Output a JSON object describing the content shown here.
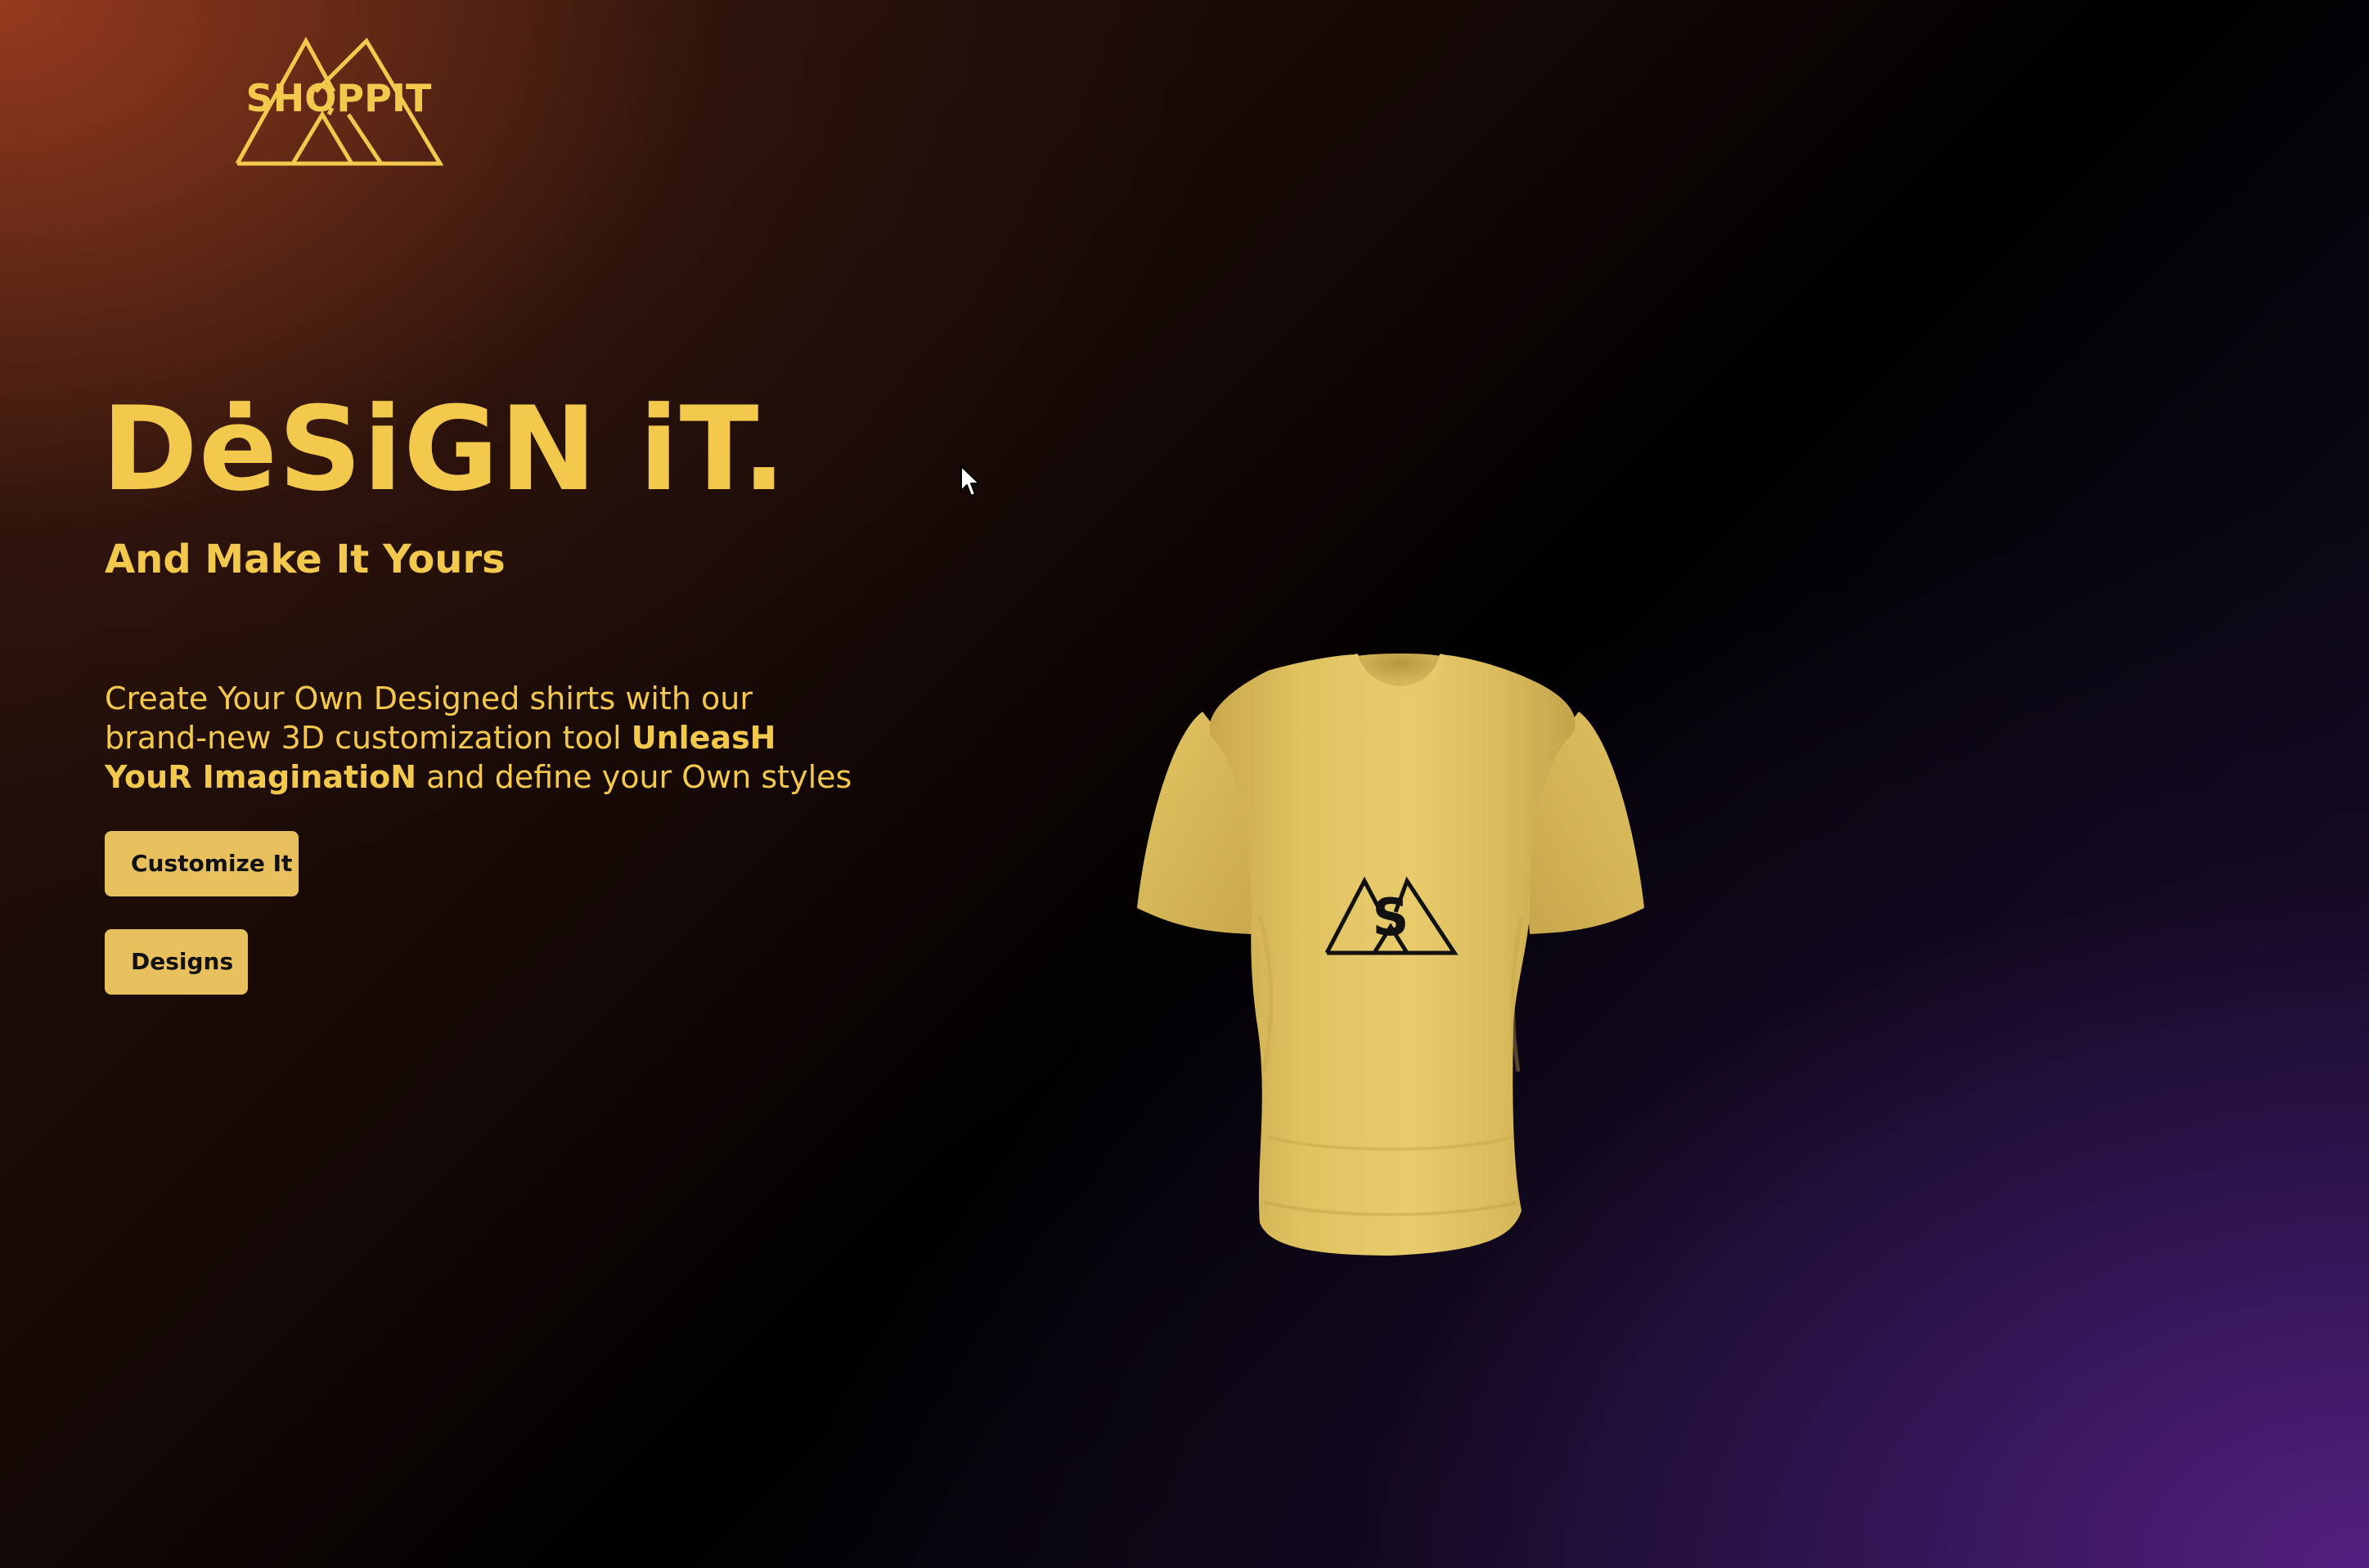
{
  "brand": {
    "name": "SHOPPIT",
    "color": "#f2c94c"
  },
  "hero": {
    "title": "DėSiGN iT.",
    "subtitle": "And Make It Yours",
    "description_part1": "Create Your Own Designed shirts with our brand-new 3D customization tool ",
    "description_bold": "UnleasH YouR ImaginatioN",
    "description_part2": " and define your Own styles"
  },
  "buttons": {
    "customize_label": "Customize It",
    "designs_label": "Designs",
    "background": "#e9c05e",
    "text_color": "#111111"
  },
  "shirt": {
    "color": "#e5c866",
    "decal_letter": "S",
    "decal_icon": "triangle-logo-icon"
  },
  "colors": {
    "accent": "#f2c94c",
    "bg_top_left": "#963a1e",
    "bg_bottom_right": "#542080",
    "bg_mid": "#000000"
  }
}
